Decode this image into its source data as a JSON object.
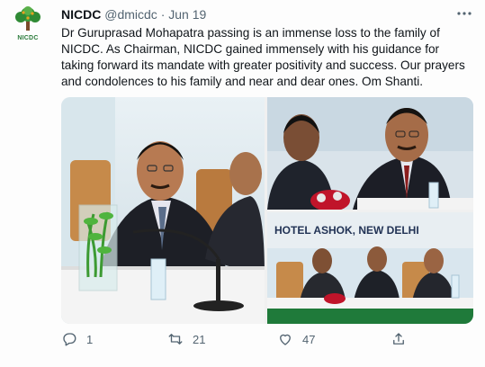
{
  "tweet": {
    "author_name": "NICDC",
    "handle": "@dmicdc",
    "separator": "·",
    "date": "Jun 19",
    "avatar_label": "NICDC",
    "more_icon": "ellipsis-icon",
    "text": "Dr Guruprasad Mohapatra passing is an immense loss to the family of NICDC. As Chairman, NICDC gained immensely with his guidance for taking forward its mandate with greater positivity and success. Our prayers and condolences to his family and near and dear ones. Om Shanti.",
    "media": {
      "banner_text": "HOTEL ASHOK, NEW DELHI"
    },
    "actions": {
      "reply_count": "1",
      "retweet_count": "21",
      "like_count": "47"
    }
  },
  "colors": {
    "text": "#0f1419",
    "muted": "#536471",
    "brand_green": "#2a7a3a"
  }
}
